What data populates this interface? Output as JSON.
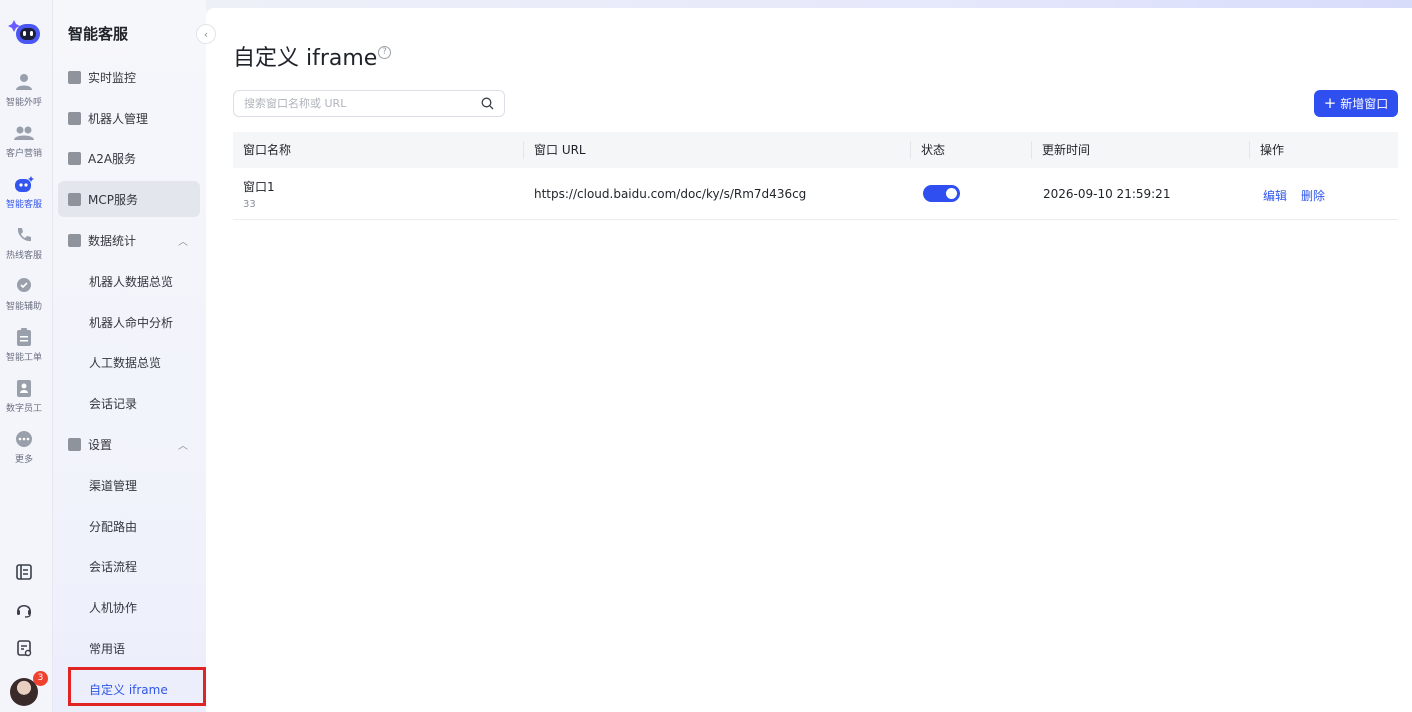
{
  "rail": {
    "items": [
      {
        "label": "智能外呼",
        "icon": "phone-robot-icon"
      },
      {
        "label": "客户营销",
        "icon": "users-icon"
      },
      {
        "label": "智能客服",
        "icon": "robot-service-icon",
        "active": true
      },
      {
        "label": "热线客服",
        "icon": "hotline-icon"
      },
      {
        "label": "智能辅助",
        "icon": "assist-icon"
      },
      {
        "label": "智能工单",
        "icon": "clipboard-icon"
      },
      {
        "label": "数字员工",
        "icon": "badge-icon"
      },
      {
        "label": "更多",
        "icon": "more-icon"
      }
    ],
    "notification_count": "3"
  },
  "sidebar": {
    "title": "智能客服",
    "items": [
      {
        "label": "实时监控"
      },
      {
        "label": "机器人管理"
      },
      {
        "label": "A2A服务"
      },
      {
        "label": "MCP服务"
      },
      {
        "label": "数据统计"
      }
    ],
    "stats_children": [
      "机器人数据总览",
      "机器人命中分析",
      "人工数据总览",
      "会话记录"
    ],
    "settings_label": "设置",
    "settings_children": [
      "渠道管理",
      "分配路由",
      "会话流程",
      "人机协作",
      "常用语",
      "自定义 iframe"
    ]
  },
  "page": {
    "title": "自定义 iframe",
    "help": "?",
    "search_placeholder": "搜索窗口名称或 URL",
    "add_button": "新增窗口"
  },
  "table": {
    "columns": [
      "窗口名称",
      "窗口 URL",
      "状态",
      "更新时间",
      "操作"
    ],
    "rows": [
      {
        "name": "窗口1",
        "sub": "33",
        "url": "https://cloud.baidu.com/doc/ky/s/Rm7d436cg",
        "enabled": true,
        "updated": "2026-09-10 21:59:21",
        "edit": "编辑",
        "delete": "删除"
      }
    ]
  },
  "colors": {
    "accent": "#2f4ff0",
    "link": "#2f56e8",
    "highlight_box": "#e02424"
  }
}
